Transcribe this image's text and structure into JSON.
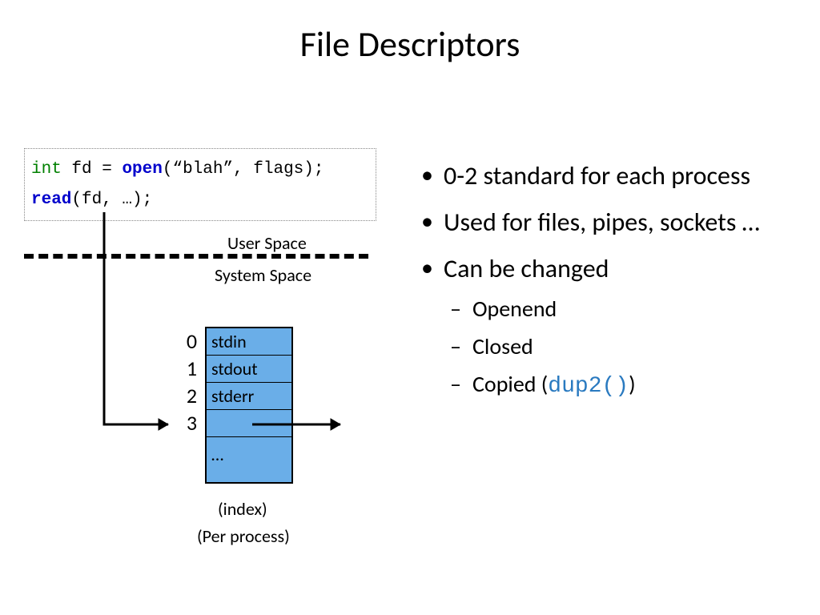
{
  "title": "File Descriptors",
  "code": {
    "type_kw": "int",
    "var": " fd = ",
    "open_kw": "open",
    "open_args": "(“blah”, flags);",
    "read_kw": "read",
    "read_args": "(fd, …);"
  },
  "labels": {
    "user_space": "User Space",
    "system_space": "System Space",
    "index": "(index)",
    "per_process": "(Per process)"
  },
  "fd_table": {
    "indices": [
      "0",
      "1",
      "2",
      "3"
    ],
    "rows": [
      "stdin",
      "stdout",
      "stderr",
      "",
      "…"
    ]
  },
  "bullets": {
    "b1": "0-2 standard for each process",
    "b2": "Used for files, pipes, sockets …",
    "b3": "Can be changed",
    "sub1": "Openend",
    "sub2": "Closed",
    "sub3_pre": "Copied (",
    "sub3_code": "dup2()",
    "sub3_post": ")"
  }
}
